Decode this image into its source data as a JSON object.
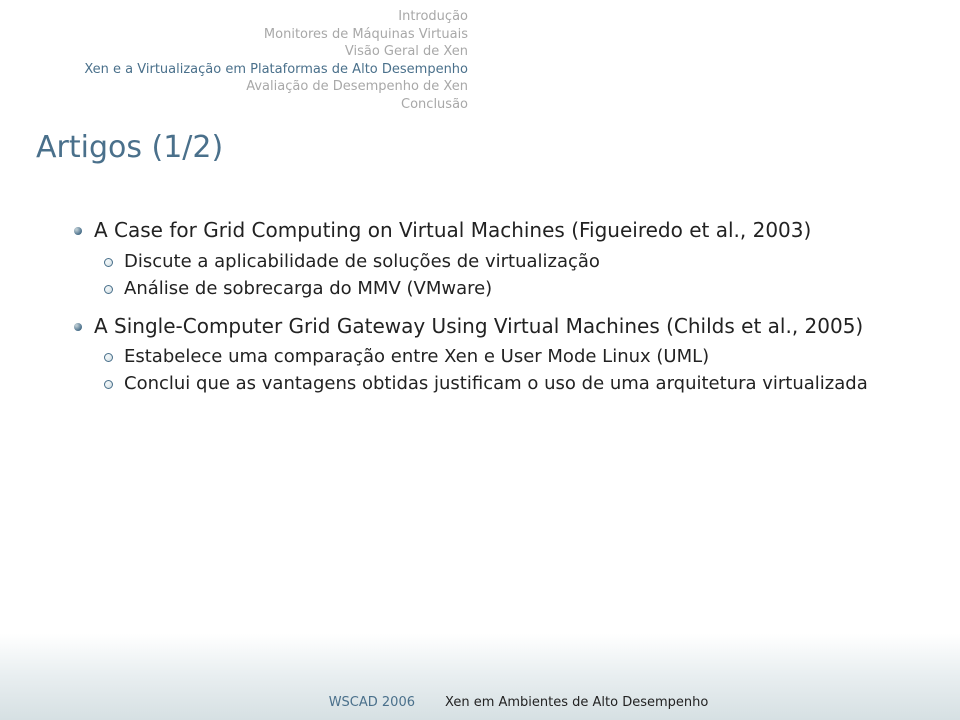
{
  "nav": {
    "items": [
      {
        "label": "Introdução",
        "highlight": false
      },
      {
        "label": "Monitores de Máquinas Virtuais",
        "highlight": false
      },
      {
        "label": "Visão Geral de Xen",
        "highlight": false
      },
      {
        "label": "Xen e a Virtualização em Plataformas de Alto Desempenho",
        "highlight": true
      },
      {
        "label": "Avaliação de Desempenho de Xen",
        "highlight": false
      },
      {
        "label": "Conclusão",
        "highlight": false
      }
    ]
  },
  "title": "Artigos (1/2)",
  "content": {
    "items": [
      {
        "text": "A Case for Grid Computing on Virtual Machines (Figueiredo et al., 2003)",
        "children": [
          "Discute a aplicabilidade de soluções de virtualização",
          "Análise de sobrecarga do MMV (VMware)"
        ]
      },
      {
        "text": "A Single-Computer Grid Gateway Using Virtual Machines (Childs et al., 2005)",
        "children": [
          "Estabelece uma comparação entre Xen e User Mode Linux (UML)",
          "Conclui que as vantagens obtidas justificam o uso de uma arquitetura virtualizada"
        ]
      }
    ]
  },
  "footer": {
    "left": "WSCAD 2006",
    "right": "Xen em Ambientes de Alto Desempenho"
  }
}
